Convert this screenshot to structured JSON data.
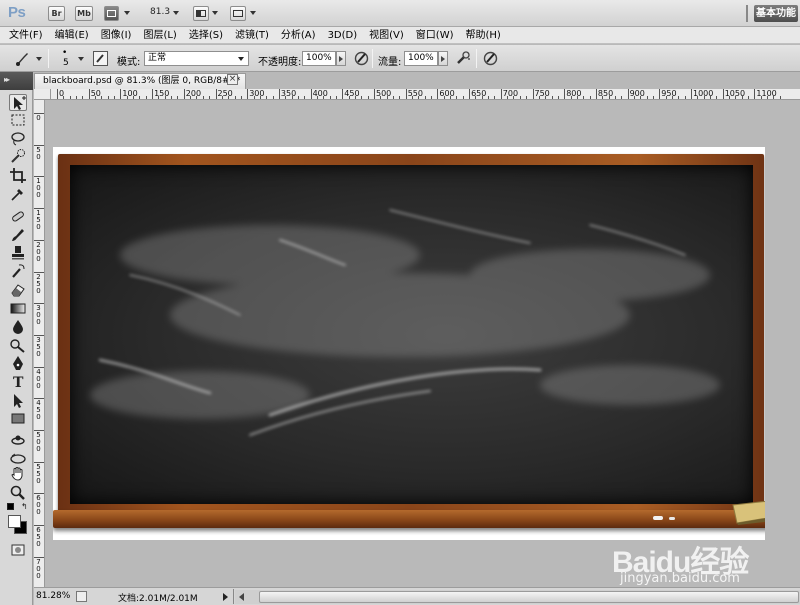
{
  "app": {
    "logo": "Ps",
    "bridge_label": "Br",
    "minibridge_label": "Mb",
    "zoom_value": "81.3",
    "workspace_label": "基本功能"
  },
  "menu": [
    "文件(F)",
    "编辑(E)",
    "图像(I)",
    "图层(L)",
    "选择(S)",
    "滤镜(T)",
    "分析(A)",
    "3D(D)",
    "视图(V)",
    "窗口(W)",
    "帮助(H)"
  ],
  "options": {
    "brush_size": "5",
    "mode_label": "模式:",
    "mode_value": "正常",
    "opacity_label": "不透明度:",
    "opacity_value": "100%",
    "flow_label": "流量:",
    "flow_value": "100%"
  },
  "document": {
    "tab_title": "blackboard.psd @ 81.3% (图层 0, RGB/8#) *",
    "close_glyph": "×"
  },
  "ruler_h": [
    "0",
    "50",
    "100",
    "150",
    "200",
    "250",
    "300",
    "350",
    "400",
    "450",
    "500",
    "550",
    "600",
    "650",
    "700",
    "750",
    "800",
    "850",
    "900",
    "950",
    "1000",
    "1050",
    "1100"
  ],
  "ruler_v": [
    "0",
    "50",
    "100",
    "150",
    "200",
    "250",
    "300",
    "350",
    "400",
    "450",
    "500",
    "550",
    "600",
    "650",
    "700"
  ],
  "status": {
    "zoom": "81.28%",
    "doc_info": "文档:2.01M/2.01M"
  },
  "watermark": {
    "logo": "Baidu经验",
    "url": "jingyan.baidu.com"
  },
  "colors": {
    "foreground": "#ffffff",
    "background": "#000000",
    "board": "#2e2e2e",
    "frame": "#8a451a"
  },
  "tools": [
    "move-tool",
    "marquee-tool",
    "lasso-tool",
    "quick-select-tool",
    "crop-tool",
    "eyedropper-tool",
    "healing-brush-tool",
    "brush-tool",
    "clone-stamp-tool",
    "history-brush-tool",
    "eraser-tool",
    "gradient-tool",
    "blur-tool",
    "dodge-tool",
    "pen-tool",
    "type-tool",
    "path-select-tool",
    "shape-tool",
    "3d-rotate-tool",
    "3d-orbit-tool",
    "hand-tool",
    "zoom-tool"
  ]
}
